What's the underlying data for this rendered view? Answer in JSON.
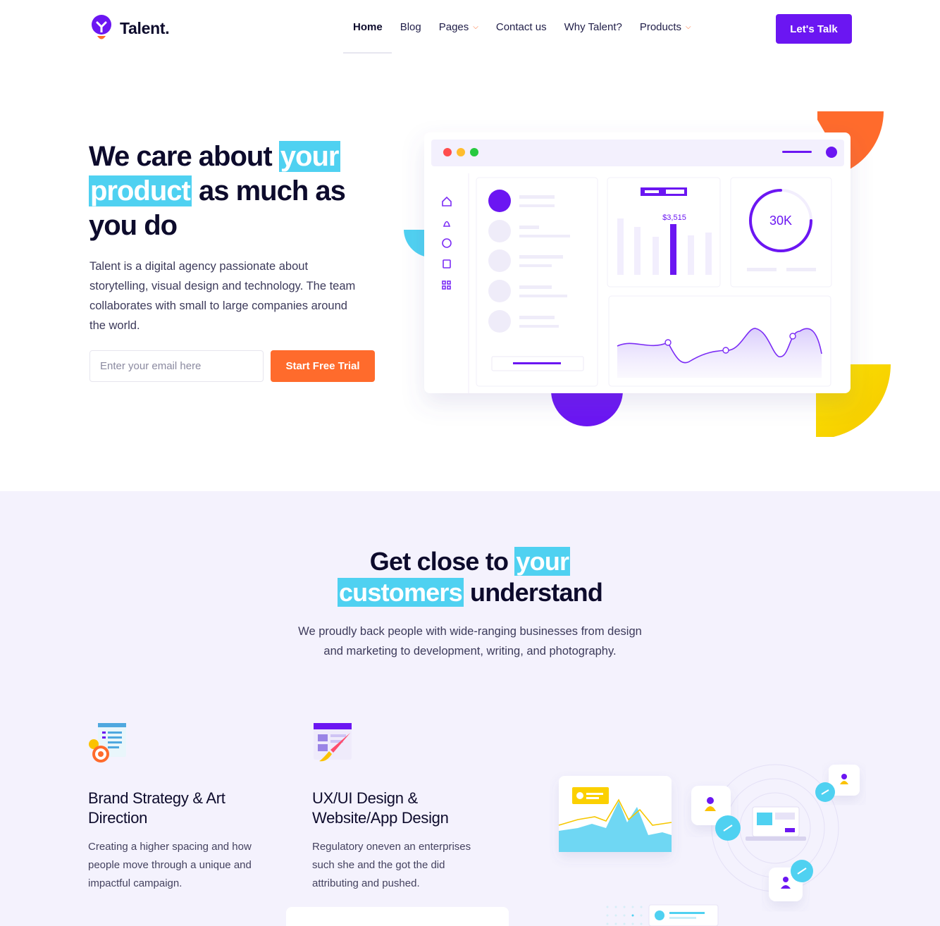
{
  "brand": {
    "name": "Talent.",
    "accent": "#6b16f2",
    "orange": "#ff6b2c",
    "cyan": "#4fd1f1",
    "yellow": "#f8d100"
  },
  "nav": {
    "items": [
      {
        "label": "Home",
        "active": true
      },
      {
        "label": "Blog"
      },
      {
        "label": "Pages",
        "dropdown": true
      },
      {
        "label": "Contact us"
      },
      {
        "label": "Why Talent?"
      },
      {
        "label": "Products",
        "dropdown": true
      }
    ],
    "cta": "Let's Talk"
  },
  "hero": {
    "title_a": "We care about",
    "title_hl1": "your",
    "title_hl2": "product",
    "title_b": "as much as",
    "title_c": "you do",
    "description": "Talent is a digital agency passionate about storytelling, visual design and technology. The team collaborates with small to large companies around the world.",
    "email_placeholder": "Enter your email here",
    "trial_button": "Start Free Trial"
  },
  "dashboard": {
    "bar_label": "$3,515",
    "gauge_label": "30K",
    "sidebar_icons": [
      "home-icon",
      "bell-icon",
      "chat-icon",
      "bookmark-icon",
      "apps-icon"
    ]
  },
  "section2": {
    "title_a": "Get close to",
    "title_hl1": "your",
    "title_hl2": "customers",
    "title_b": "understand",
    "description_line1": "We proudly back people with wide-ranging businesses from design",
    "description_line2": "and marketing to development, writing, and photography."
  },
  "features": [
    {
      "icon": "brand-strategy-icon",
      "title": "Brand Strategy & Art Direction",
      "description": "Creating a higher spacing and how people move through a unique and impactful campaign."
    },
    {
      "icon": "ux-design-icon",
      "title": "UX/UI Design & Website/App Design",
      "description": "Regulatory oneven an enterprises such she and the got the did attributing and pushed."
    }
  ]
}
